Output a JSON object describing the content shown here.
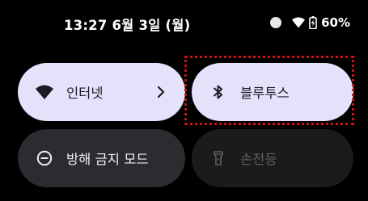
{
  "status_bar": {
    "time_date": "13:27 6월 3일 (월)",
    "battery_percent": "60%"
  },
  "tiles": {
    "internet": {
      "label": "인터넷",
      "icon": "wifi-icon",
      "state": "on"
    },
    "bluetooth": {
      "label": "블루투스",
      "icon": "bluetooth-icon",
      "state": "on"
    },
    "dnd": {
      "label": "방해 금지 모드",
      "icon": "do-not-disturb-icon",
      "state": "off"
    },
    "flashlight": {
      "label": "손전등",
      "icon": "flashlight-icon",
      "state": "disabled"
    }
  },
  "colors": {
    "background": "#000000",
    "tile_active": "#e4e2fa",
    "tile_inactive": "#2b2b30",
    "tile_disabled": "#1b1b1d",
    "highlight": "#cc1111"
  }
}
